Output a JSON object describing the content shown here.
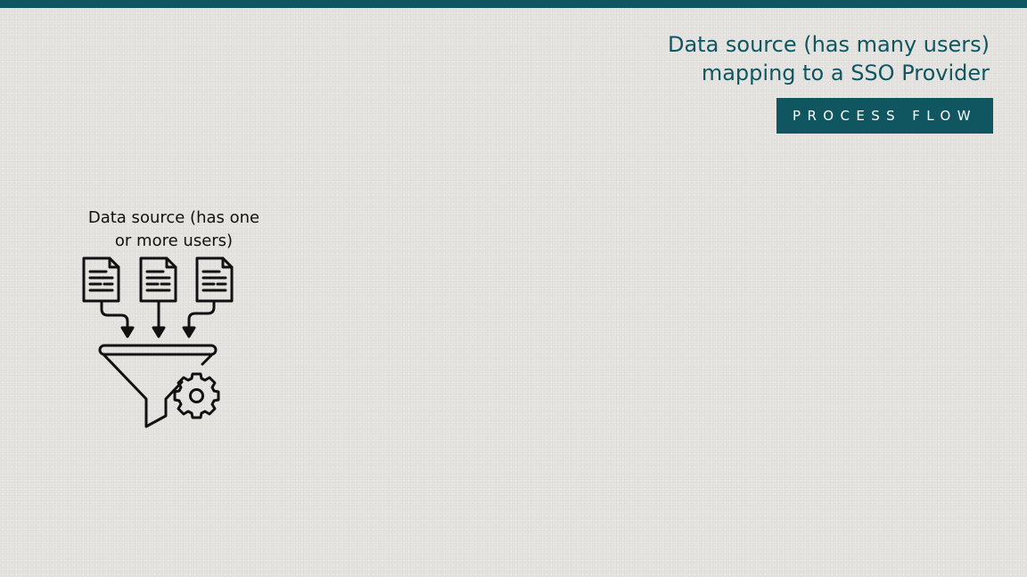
{
  "header": {
    "title_lines": [
      "Data source (has many users)",
      "mapping to a SSO Provider"
    ],
    "badge": "PROCESS FLOW"
  },
  "diagram": {
    "source_label_lines": [
      "Data source (has one",
      "or more users)"
    ],
    "icons": {
      "documents": [
        "document-icon",
        "document-icon",
        "document-icon"
      ],
      "funnel": "funnel-icon",
      "gear": "gear-icon",
      "arrows": "arrow-down-icon"
    }
  },
  "colors": {
    "accent": "#0f5661",
    "background": "#e6e4e0",
    "icon_stroke": "#111111"
  }
}
